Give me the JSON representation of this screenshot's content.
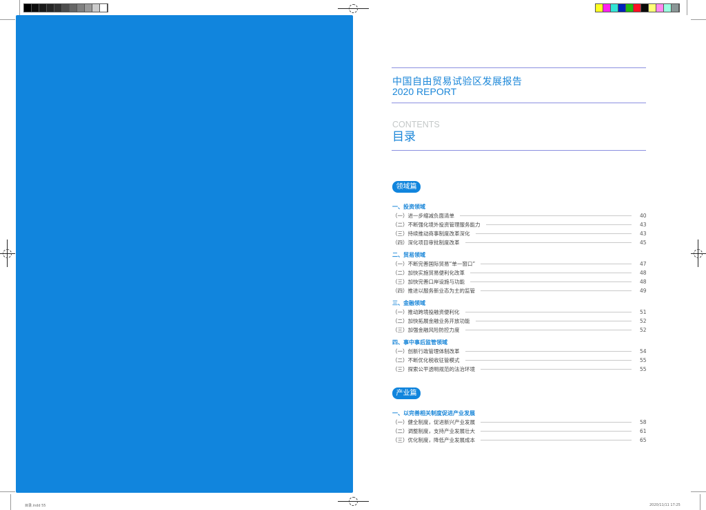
{
  "colors": {
    "accent": "#1185dd",
    "rule": "#8a8ee0",
    "text_blue": "#1a86d8"
  },
  "gray_bar": [
    "#000000",
    "#0d0d0d",
    "#1a1a1a",
    "#262626",
    "#333333",
    "#4d4d4d",
    "#666666",
    "#808080",
    "#999999",
    "#cccccc",
    "#ffffff"
  ],
  "color_bar": [
    "#ffff22",
    "#ff22ee",
    "#33e5d5",
    "#0022bb",
    "#22bb11",
    "#ff1122",
    "#0a0a0a",
    "#ffff77",
    "#ff88ee",
    "#99ffe0",
    "#8a9696"
  ],
  "header": {
    "title": "中国自由贸易试验区发展报告",
    "subtitle": "2020 REPORT"
  },
  "contents": {
    "en": "CONTENTS",
    "cn": "目录"
  },
  "parts": [
    {
      "badge": "领域篇",
      "sections": [
        {
          "heading": "一、投资领域",
          "items": [
            {
              "label": "（一）进一步缩减负面清单",
              "page": "40"
            },
            {
              "label": "（二）不断强化境外投资管理服务能力",
              "page": "43"
            },
            {
              "label": "（三）持续推动商事制度改革深化",
              "page": "43"
            },
            {
              "label": "（四）深化项目审批制度改革",
              "page": "45"
            }
          ]
        },
        {
          "heading": "二、贸易领域",
          "items": [
            {
              "label": "（一）不断完善国际贸易“单一窗口”",
              "page": "47"
            },
            {
              "label": "（二）加快实施贸易便利化改革",
              "page": "48"
            },
            {
              "label": "（三）加快完善口岸设施与功能",
              "page": "48"
            },
            {
              "label": "（四）推进以服务新业态为主的监管",
              "page": "49"
            }
          ]
        },
        {
          "heading": "三、金融领域",
          "items": [
            {
              "label": "（一）推动跨境投融资便利化",
              "page": "51"
            },
            {
              "label": "（二）加快拓展金融业务开放功能",
              "page": "52"
            },
            {
              "label": "（三）加强金融风险防控力度",
              "page": "52"
            }
          ]
        },
        {
          "heading": "四、事中事后监管领域",
          "items": [
            {
              "label": "（一）创新行政管理体制改革",
              "page": "54"
            },
            {
              "label": "（二）不断优化税收征管模式",
              "page": "55"
            },
            {
              "label": "（三）探索公平透明规范的法治环境",
              "page": "55"
            }
          ]
        }
      ]
    },
    {
      "badge": "产业篇",
      "sections": [
        {
          "heading": "一、以完善相关制度促进产业发展",
          "items": [
            {
              "label": "（一）健全制度，促进新兴产业发展",
              "page": "58"
            },
            {
              "label": "（二）调整制度，支持产业发展壮大",
              "page": "61"
            },
            {
              "label": "（三）优化制度，降低产业发展成本",
              "page": "65"
            }
          ]
        }
      ]
    }
  ],
  "slugs": {
    "left": "目录.indd 55",
    "right": "2020/11/11 17:25"
  }
}
